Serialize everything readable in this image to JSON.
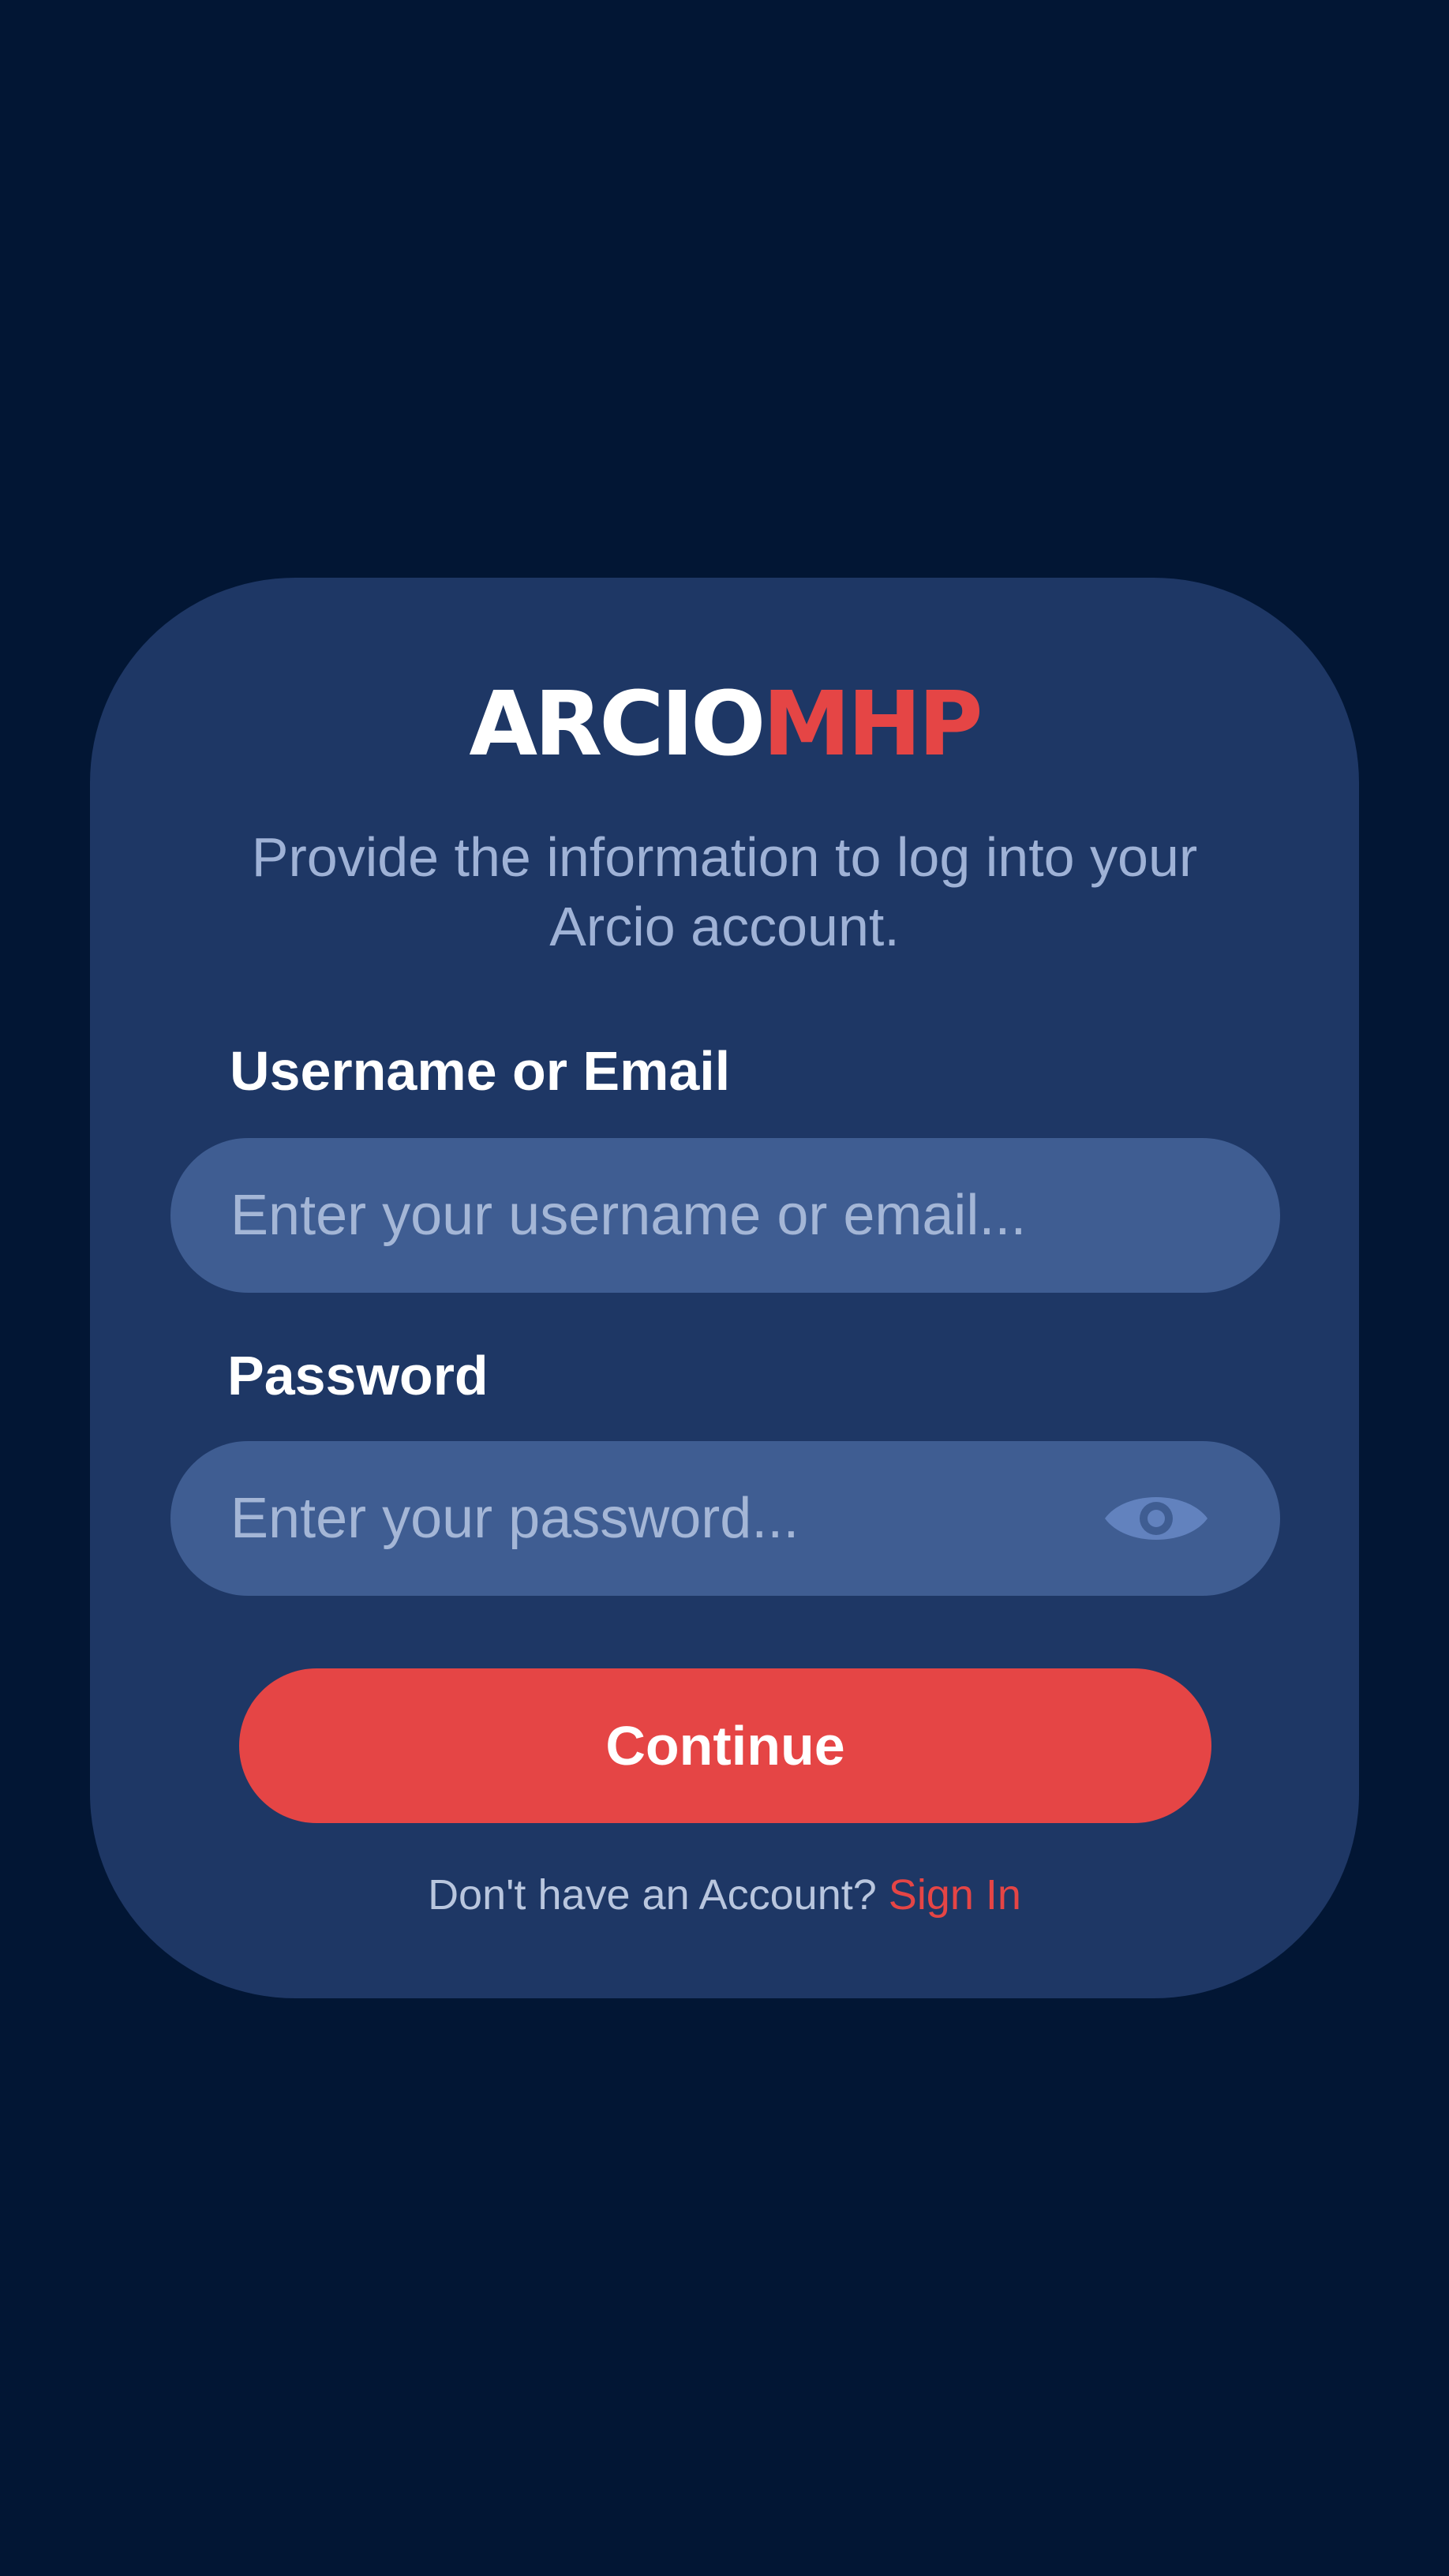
{
  "logo": {
    "part_a": "ARCIO",
    "part_b": "MHP"
  },
  "subtitle": "Provide the information to log into your Arcio account.",
  "username": {
    "label": "Username or Email",
    "placeholder": "Enter your username or email...",
    "value": ""
  },
  "password": {
    "label": "Password",
    "placeholder": "Enter your password...",
    "value": "",
    "toggle_icon": "eye-icon"
  },
  "continue_label": "Continue",
  "footer": {
    "prompt": "Don't have an Account?",
    "link": "Sign In"
  },
  "colors": {
    "background": "#021634",
    "card": "#1e3765",
    "field": "#3f5d92",
    "accent": "#e54545",
    "muted_text": "#9fb2d6"
  }
}
